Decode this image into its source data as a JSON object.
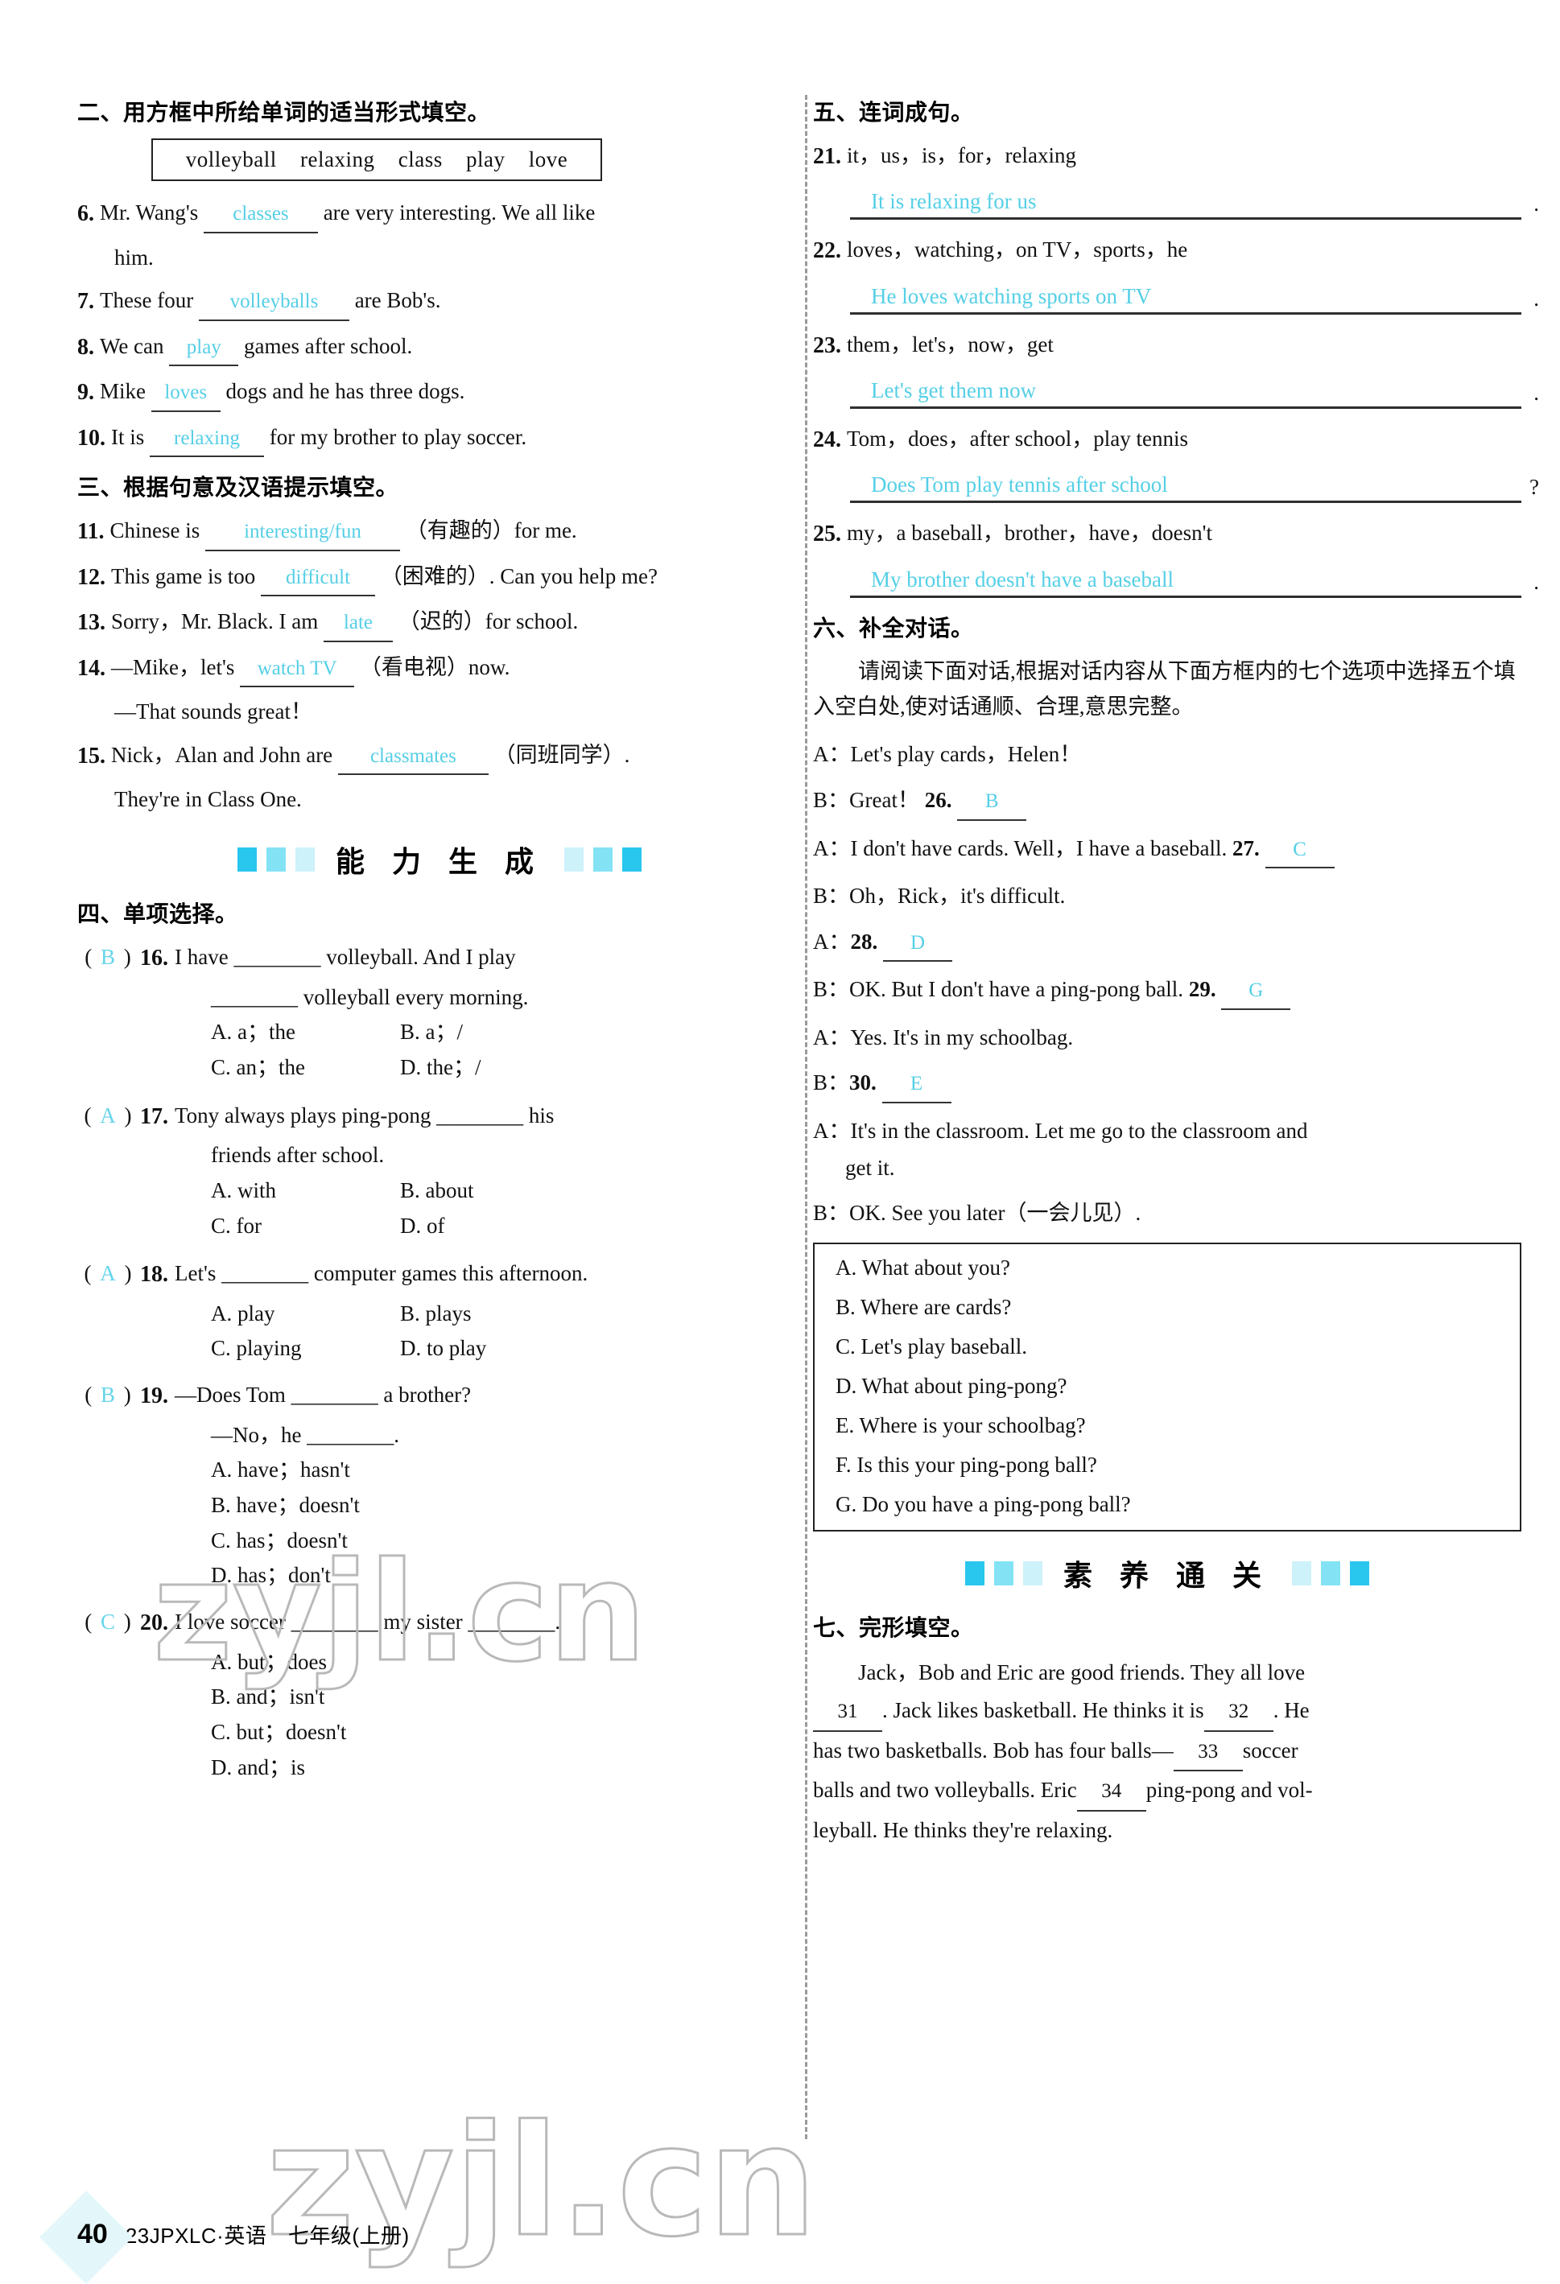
{
  "page": {
    "number": "40",
    "footer_meta": "23JPXLC·英语　七年级(上册)",
    "watermark": "zyjl.cn"
  },
  "colors": {
    "answer_ink": "#55cfe6",
    "banner_square": "#29c6ee",
    "rule": "#2f2f2f"
  },
  "banners": {
    "ability": "能 力 生 成",
    "literacy": "素 养 通 关"
  },
  "section2": {
    "heading": "二、用方框中所给单词的适当形式填空。",
    "wordbank": [
      "volleyball",
      "relaxing",
      "class",
      "play",
      "love"
    ],
    "items": [
      {
        "num": "6.",
        "pre": "Mr. Wang's",
        "answer": "classes",
        "post": "are very interesting.  We all like",
        "cont": "him."
      },
      {
        "num": "7.",
        "pre": "These four",
        "answer": "volleyballs",
        "post": "are Bob's.",
        "cont": ""
      },
      {
        "num": "8.",
        "pre": "We can",
        "answer": "play",
        "post": "games after school.",
        "cont": ""
      },
      {
        "num": "9.",
        "pre": "Mike",
        "answer": "loves",
        "post": "dogs and he has three dogs.",
        "cont": ""
      },
      {
        "num": "10.",
        "pre": "It is",
        "answer": "relaxing",
        "post": "for my brother to play soccer.",
        "cont": ""
      }
    ]
  },
  "section3": {
    "heading": "三、根据句意及汉语提示填空。",
    "items": [
      {
        "num": "11.",
        "pre": "Chinese is",
        "answer": "interesting/fun",
        "post": "（有趣的）for me.",
        "cont": ""
      },
      {
        "num": "12.",
        "pre": "This game is too",
        "answer": "difficult",
        "post": "（困难的）. Can you help me?",
        "cont": ""
      },
      {
        "num": "13.",
        "pre": "Sorry，Mr. Black.  I am",
        "answer": "late",
        "post": "（迟的）for school.",
        "cont": ""
      },
      {
        "num": "14.",
        "pre": "—Mike，let's",
        "answer": "watch TV",
        "post": "（看电视）now.",
        "cont": "—That sounds great！"
      },
      {
        "num": "15.",
        "pre": "Nick，Alan and John are",
        "answer": "classmates",
        "post": "（同班同学）.",
        "cont": "They're in Class One."
      }
    ]
  },
  "section4": {
    "heading": "四、单项选择。",
    "items": [
      {
        "answer": "B",
        "num": "16.",
        "stem": "I have ________ volleyball.  And I play",
        "stem2": "________ volleyball every morning.",
        "options": [
          "A. a；the",
          "B. a；/",
          "C. an；the",
          "D. the；/"
        ]
      },
      {
        "answer": "A",
        "num": "17.",
        "stem": "Tony always plays ping-pong ________ his",
        "stem2": "friends after school.",
        "options": [
          "A. with",
          "B. about",
          "C. for",
          "D. of"
        ]
      },
      {
        "answer": "A",
        "num": "18.",
        "stem": "Let's ________ computer games this afternoon.",
        "stem2": "",
        "options": [
          "A. play",
          "B. plays",
          "C. playing",
          "D. to play"
        ]
      },
      {
        "answer": "B",
        "num": "19.",
        "stem": "—Does Tom ________ a brother?",
        "stem2": "—No，he ________.",
        "options_stacked": [
          "A. have；hasn't",
          "B. have；doesn't",
          "C. has；doesn't",
          "D. has；don't"
        ]
      },
      {
        "answer": "C",
        "num": "20.",
        "stem": "I love soccer ________ my sister ________.",
        "stem2": "",
        "options_stacked": [
          "A. but；does",
          "B. and；isn't",
          "C. but；doesn't",
          "D. and；is"
        ]
      }
    ]
  },
  "section5": {
    "heading": "五、连词成句。",
    "items": [
      {
        "num": "21.",
        "prompt": "it，us，is，for，relaxing",
        "answer": "It is relaxing for us",
        "mark": "."
      },
      {
        "num": "22.",
        "prompt": "loves，watching，on TV，sports，he",
        "answer": "He loves watching sports on TV",
        "mark": "."
      },
      {
        "num": "23.",
        "prompt": "them，let's，now，get",
        "answer": "Let's get them now",
        "mark": "."
      },
      {
        "num": "24.",
        "prompt": "Tom，does，after school，play tennis",
        "answer": "Does Tom play tennis after school",
        "mark": "?"
      },
      {
        "num": "25.",
        "prompt": "my，a baseball，brother，have，doesn't",
        "answer": "My brother doesn't have a baseball",
        "mark": "."
      }
    ]
  },
  "section6": {
    "heading": "六、补全对话。",
    "instruction": "请阅读下面对话,根据对话内容从下面方框内的七个选项中选择五个填入空白处,使对话通顺、合理,意思完整。",
    "dialogue": [
      {
        "speaker": "A：",
        "text": "Let's play cards，Helen！",
        "num": "",
        "answer": "",
        "tail": ""
      },
      {
        "speaker": "B：",
        "text": "Great！",
        "num": "26.",
        "answer": "B",
        "tail": ""
      },
      {
        "speaker": "A：",
        "text": "I don't have cards.  Well，I have a baseball.",
        "num": "27.",
        "answer": "C",
        "tail": ""
      },
      {
        "speaker": "B：",
        "text": "Oh，Rick，it's difficult.",
        "num": "",
        "answer": "",
        "tail": ""
      },
      {
        "speaker": "A：",
        "text": "",
        "num": "28.",
        "answer": "D",
        "tail": ""
      },
      {
        "speaker": "B：",
        "text": "OK.  But I don't have a ping-pong ball.",
        "num": "29.",
        "answer": "G",
        "tail": ""
      },
      {
        "speaker": "A：",
        "text": "Yes.  It's in my schoolbag.",
        "num": "",
        "answer": "",
        "tail": ""
      },
      {
        "speaker": "B：",
        "text": "",
        "num": "30.",
        "answer": "E",
        "tail": ""
      },
      {
        "speaker": "A：",
        "text": "It's in the classroom.  Let me go to the classroom and",
        "num": "",
        "answer": "",
        "tail": "get it."
      },
      {
        "speaker": "B：",
        "text": "OK.  See you later（一会儿见）.",
        "num": "",
        "answer": "",
        "tail": ""
      }
    ],
    "options": [
      "A. What about you?",
      "B. Where are cards?",
      "C. Let's play baseball.",
      "D. What about ping-pong?",
      "E. Where is your schoolbag?",
      "F. Is this your ping-pong ball?",
      "G. Do you have a ping-pong ball?"
    ]
  },
  "section7": {
    "heading": "七、完形填空。",
    "passage_parts": {
      "p1": "Jack，Bob and Eric are good friends.  They all love",
      "n1": "31",
      "p2": ".  Jack likes basketball.  He thinks it is",
      "n2": "32",
      "p3": ".  He",
      "p4": "has two basketballs.  Bob has four balls—",
      "n3": "33",
      "p5": "soccer",
      "p6": "balls and two volleyballs.  Eric",
      "n4": "34",
      "p7": "ping-pong and vol-",
      "p8": "leyball.  He thinks they're relaxing."
    }
  }
}
